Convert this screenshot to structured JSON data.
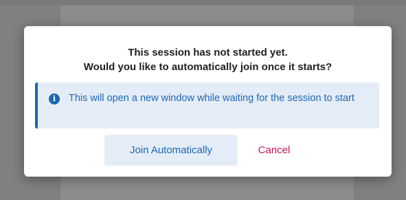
{
  "dialog": {
    "title_line1": "This session has not started yet.",
    "title_line2": "Would you like to automatically join once it starts?",
    "info": {
      "icon": "info-icon",
      "text": "This will open a new window while waiting for the session to start"
    },
    "buttons": {
      "join_label": "Join Automatically",
      "cancel_label": "Cancel"
    }
  },
  "colors": {
    "accent": "#1b66b3",
    "info_bg": "#e4edf7",
    "cancel": "#c2185b",
    "overlay": "#808080"
  }
}
